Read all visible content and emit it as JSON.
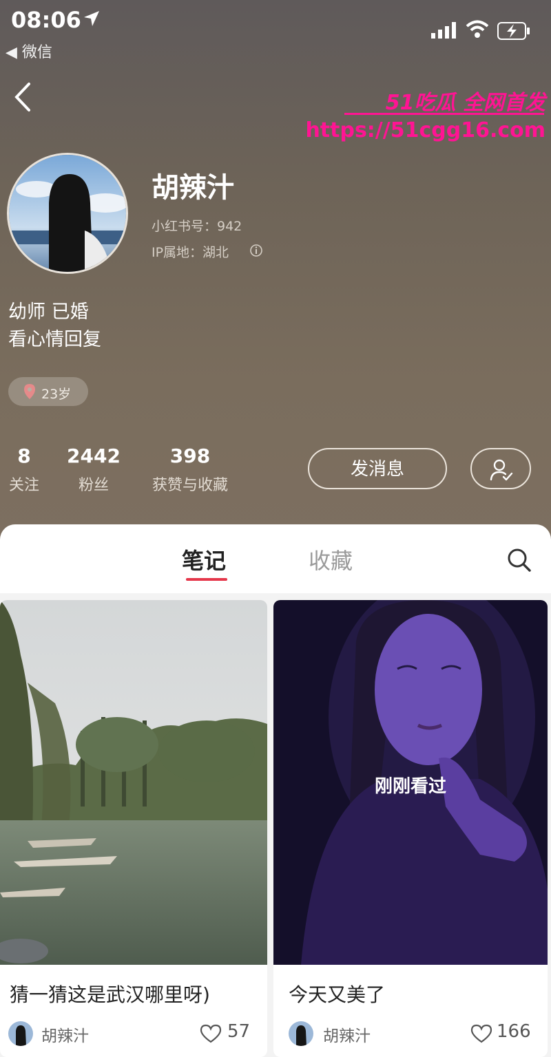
{
  "status_bar": {
    "time": "08:06",
    "back_app": "◀ 微信"
  },
  "watermark": {
    "line1": "51吃瓜 全网首发",
    "line2": "https://51cgg16.com"
  },
  "profile": {
    "name": "胡辣汁",
    "redbook_id": "小红书号：942",
    "ip_location": "IP属地：湖北",
    "bio_line1": "幼师 已婚",
    "bio_line2": "看心情回复",
    "age_badge": "23岁"
  },
  "stats": [
    {
      "value": "8",
      "label": "关注"
    },
    {
      "value": "2442",
      "label": "粉丝"
    },
    {
      "value": "398",
      "label": "获赞与收藏"
    }
  ],
  "actions": {
    "message_label": "发消息"
  },
  "tabs": {
    "notes": "笔记",
    "collections": "收藏"
  },
  "notes": [
    {
      "title": "猜一猜这是武汉哪里呀)",
      "author": "胡辣汁",
      "likes": "57"
    },
    {
      "title": "今天又美了",
      "author": "胡辣汁",
      "likes": "166",
      "overlay": "刚刚看过"
    }
  ],
  "colors": {
    "accent": "#e5364a",
    "watermark": "#ff1493"
  }
}
